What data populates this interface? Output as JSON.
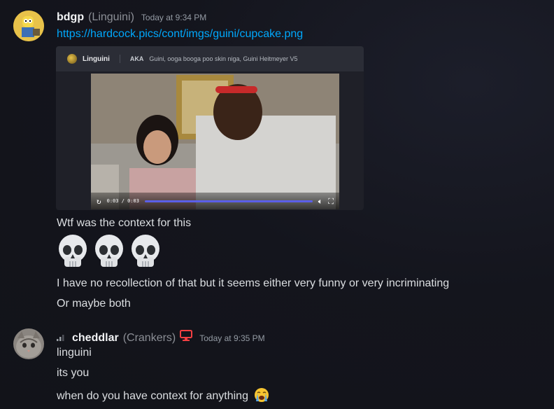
{
  "messages": [
    {
      "username": "bdgp",
      "nickname": "(Linguini)",
      "timestamp": "Today at 9:34 PM",
      "link": "https://hardcock.pics/cont/imgs/guini/cupcake.png",
      "embed": {
        "name": "Linguini",
        "aka_label": "AKA",
        "aka_text": "Guini, ooga booga poo skin niga, Guini Heitmeyer V5",
        "video_time": "0:03 / 0:03",
        "video_progress": 1.0
      },
      "lines": [
        "Wtf was the context for this",
        "I have no recollection of that but it seems either very funny or very incriminating",
        "Or maybe both"
      ],
      "emoji": [
        "skull-emoji",
        "skull-emoji",
        "skull-emoji"
      ]
    },
    {
      "username": "cheddlar",
      "nickname": "(Crankers)",
      "timestamp": "Today at 9:35 PM",
      "lines": [
        "linguini",
        "its you",
        "when do you have context for anything"
      ],
      "trailing_emoji": "loudly-crying-emoji"
    }
  ],
  "colors": {
    "background": "#14151c",
    "link": "#00a8fc",
    "username": "#f2f3f5",
    "muted": "#949ba4",
    "progress": "#5b5fe8",
    "device_icon": "#f23f42"
  }
}
